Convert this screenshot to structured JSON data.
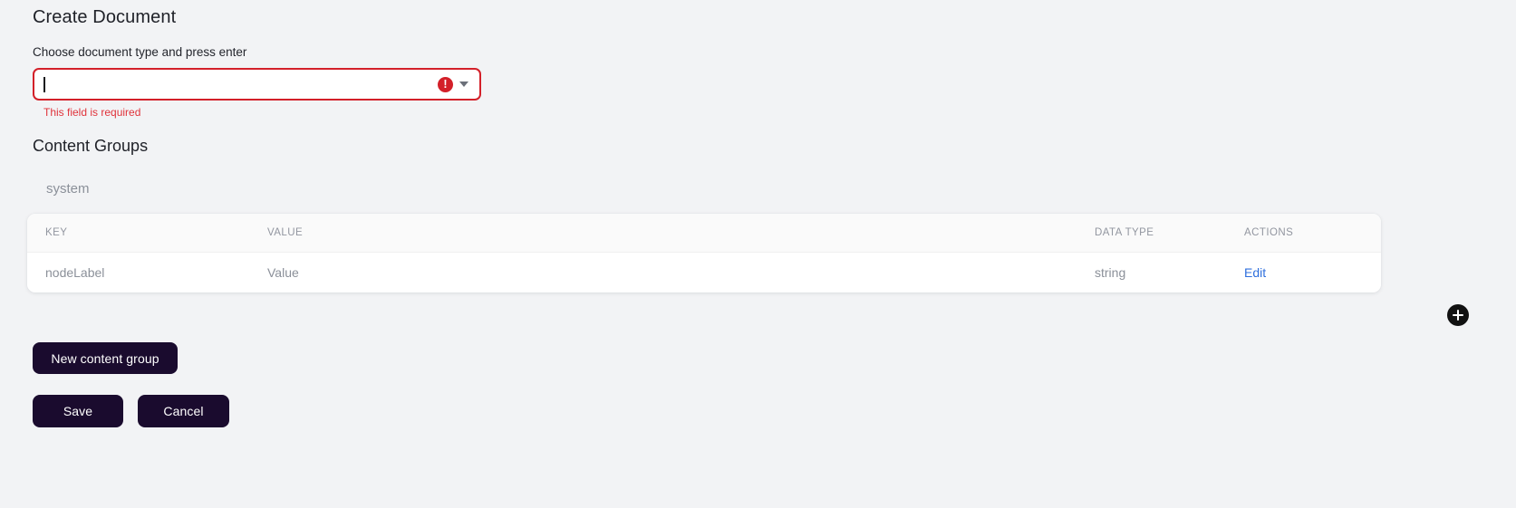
{
  "page": {
    "title": "Create Document",
    "background_color": "#f2f3f5"
  },
  "document_type_field": {
    "label": "Choose document type and press enter",
    "value": "",
    "placeholder": "",
    "error_message": "This field is required",
    "error_icon": "error-exclamation-icon",
    "dropdown_icon": "chevron-down-icon",
    "border_color": "#d32029",
    "error_text_color": "#e0333b",
    "state": "invalid"
  },
  "content_groups": {
    "section_title": "Content Groups",
    "group_name": "system",
    "table": {
      "columns": [
        "KEY",
        "VALUE",
        "DATA TYPE",
        "ACTIONS"
      ],
      "rows": [
        {
          "key": "nodeLabel",
          "value": "Value",
          "data_type": "string",
          "action_label": "Edit"
        }
      ],
      "link_color": "#2f6fdd"
    },
    "add_button": {
      "icon": "plus-icon",
      "label": "",
      "color": "#111111"
    },
    "new_group_button": "New content group"
  },
  "form_actions": {
    "save_label": "Save",
    "cancel_label": "Cancel",
    "button_color": "#1a0b2e"
  }
}
